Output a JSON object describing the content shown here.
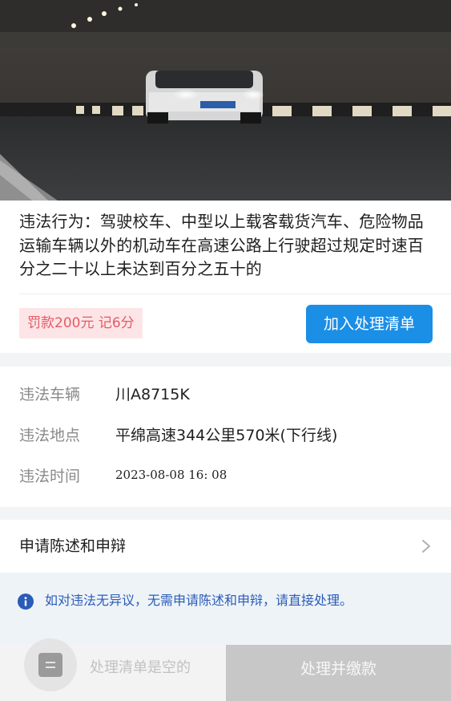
{
  "violation": {
    "description": "违法行为：驾驶校车、中型以上载客载货汽车、危险物品运输车辆以外的机动车在高速公路上行驶超过规定时速百分之二十以上未达到百分之五十的",
    "penalty": "罚款200元  记6分",
    "add_button_label": "加入处理清单"
  },
  "details": {
    "vehicle_label": "违法车辆",
    "vehicle_value": "川A8715K",
    "location_label": "违法地点",
    "location_value": "平绵高速344公里570米(下行线)",
    "time_label": "违法时间",
    "time_value": "2023-08-08 16: 08"
  },
  "appeal": {
    "label": "申请陈述和申辩"
  },
  "notice": {
    "text": "如对违法无异议，无需申请陈述和申辩，请直接处理。"
  },
  "bottom": {
    "list_empty_text": "处理清单是空的",
    "pay_button_label": "处理并缴款"
  },
  "icons": {
    "list": "list-icon",
    "chevron": "chevron-right-icon",
    "info": "info-icon"
  },
  "colors": {
    "primary": "#1b8ee6",
    "penalty_text": "#e45b66",
    "penalty_bg": "#fde5e7",
    "notice_text": "#2a5cb8",
    "disabled_button": "#c7c7c7"
  }
}
